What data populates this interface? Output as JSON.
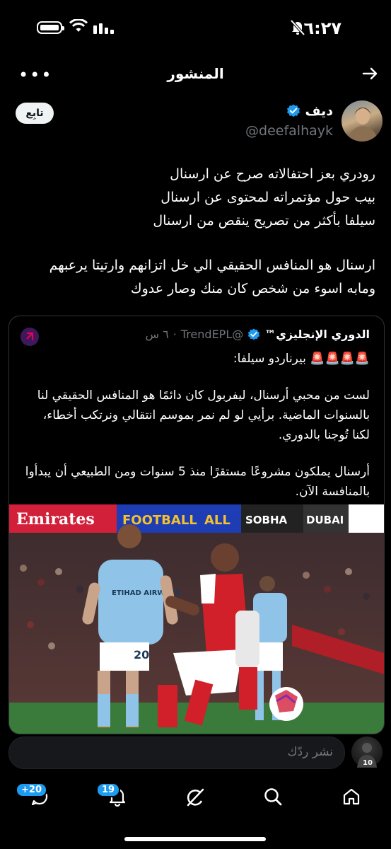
{
  "status_bar": {
    "time": "٦:٢٧"
  },
  "header": {
    "title": "المنشور"
  },
  "post": {
    "author_name": "ديف",
    "author_handle": "@deefalhayk",
    "follow_label": "تابِع",
    "lines": [
      "رودري بعز احتفالاته صرح عن ارسنال",
      "بيب حول مؤتمراته لمحتوى عن ارسنال",
      "سيلفا بأكثر من تصريح ينقص من ارسنال",
      "",
      "ارسنال هو المنافس الحقيقي الي خل اتزانهم وارتيتا يرعبهم",
      "ومابه اسوء من شخص كان منك وصار عدوك"
    ]
  },
  "quote": {
    "name": "الدوري الإنجليزي™",
    "handle": "@TrendEPL",
    "time": "٦ س",
    "headline": "🚨🚨🚨🚨 بيرناردو سيلفا:",
    "paragraph1": "لست من محبي أرسنال، ليفربول كان دائمًا هو المنافس الحقيقي لنا بالسنوات الماضية. برأيي لو لم نمر بموسم انتقالي ونرتكب أخطاء، لكنا تُوجنا بالدوري.",
    "paragraph2": "أرسنال يملكون مشروعًا مستقرًا منذ 5 سنوات ومن الطبيعي أن يبدأوا بالمنافسة الآن.",
    "photo_banners": [
      "Emirates",
      "FOOTBALL",
      "SOBHA",
      "DUBAI"
    ],
    "sponsor": "ETIHAD AIRWAYS",
    "shirt_number": "20"
  },
  "reply": {
    "placeholder": "نشر ردّك"
  },
  "nav": {
    "messages_badge": "+20",
    "notifications_badge": "19"
  },
  "colors": {
    "accent": "#1d9bf0",
    "background": "#000000"
  }
}
